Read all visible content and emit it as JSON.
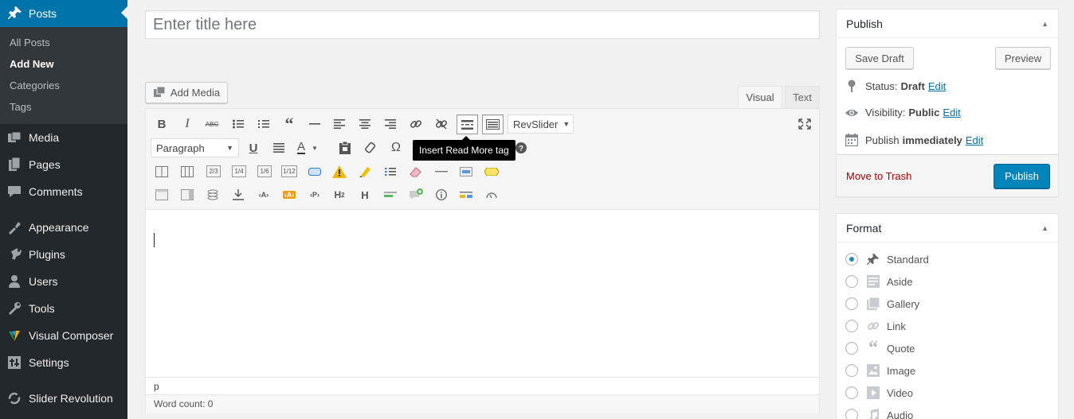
{
  "sidebar": {
    "active": "Posts",
    "submenu": [
      "All Posts",
      "Add New",
      "Categories",
      "Tags"
    ],
    "items": [
      {
        "label": "Media",
        "icon": "media-icon"
      },
      {
        "label": "Pages",
        "icon": "pages-icon"
      },
      {
        "label": "Comments",
        "icon": "comments-icon"
      },
      {
        "label": "Appearance",
        "icon": "appearance-icon"
      },
      {
        "label": "Plugins",
        "icon": "plugins-icon"
      },
      {
        "label": "Users",
        "icon": "users-icon"
      },
      {
        "label": "Tools",
        "icon": "tools-icon"
      },
      {
        "label": "Visual Composer",
        "icon": "visual-composer-icon"
      },
      {
        "label": "Settings",
        "icon": "settings-icon"
      },
      {
        "label": "Slider Revolution",
        "icon": "slider-revolution-icon"
      }
    ]
  },
  "title_field": {
    "value": "",
    "placeholder": "Enter title here"
  },
  "editor": {
    "add_media": "Add Media",
    "tab_visual": "Visual",
    "tab_text": "Text",
    "revslider": "RevSlider",
    "format_select": "Paragraph",
    "tooltip": "Insert Read More tag",
    "path": "p",
    "word_count": "Word count: 0",
    "fraction_labels": [
      "2/3",
      "1/4",
      "1/6",
      "1/12"
    ]
  },
  "publish": {
    "title": "Publish",
    "save_draft": "Save Draft",
    "preview": "Preview",
    "status_label": "Status:",
    "status_value": "Draft",
    "visibility_label": "Visibility:",
    "visibility_value": "Public",
    "schedule_label": "Publish",
    "schedule_value": "immediately",
    "edit": "Edit",
    "trash": "Move to Trash",
    "publish_button": "Publish"
  },
  "format": {
    "title": "Format",
    "selected": "Standard",
    "options": [
      "Standard",
      "Aside",
      "Gallery",
      "Link",
      "Quote",
      "Image",
      "Video",
      "Audio"
    ]
  },
  "colors": {
    "sidebar": "#23282d",
    "accent": "#0073aa",
    "publish": "#0085ba",
    "trash": "#aa0000"
  }
}
